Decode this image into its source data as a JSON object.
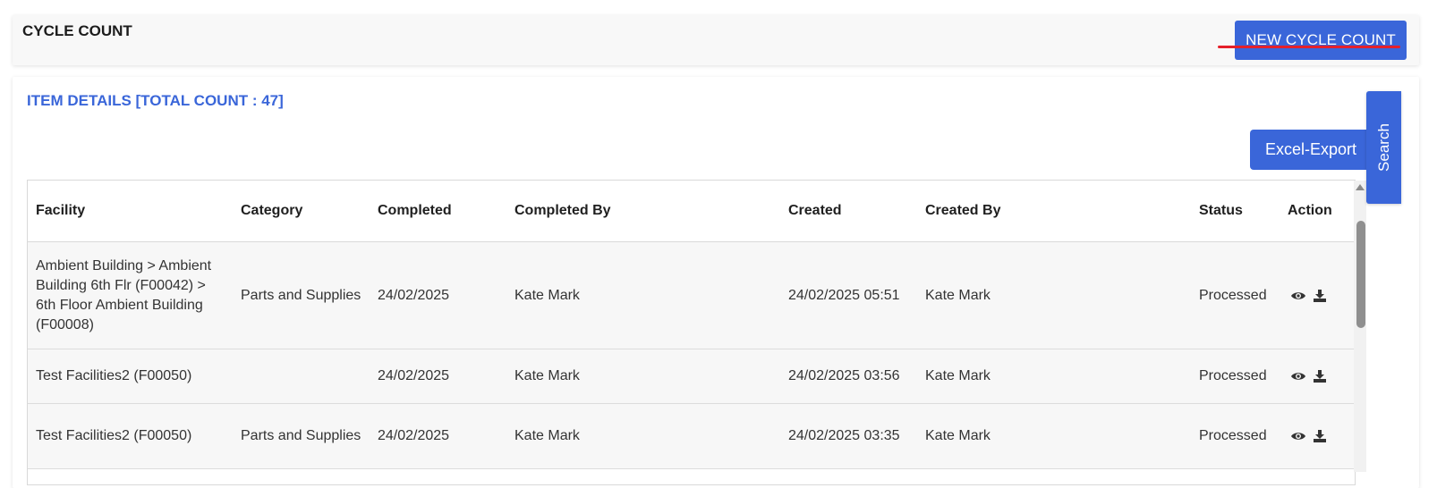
{
  "header": {
    "title": "CYCLE COUNT",
    "new_button": "NEW CYCLE COUNT"
  },
  "section": {
    "title": "ITEM DETAILS [TOTAL COUNT : 47]"
  },
  "buttons": {
    "excel_export": "Excel-Export",
    "search": "Search"
  },
  "colors": {
    "accent": "#3a66d9",
    "active_underline": "#e5202a"
  },
  "table": {
    "columns": [
      "Facility",
      "Category",
      "Completed",
      "Completed By",
      "Created",
      "Created By",
      "Status",
      "Action"
    ],
    "rows": [
      {
        "facility": "Ambient Building > Ambient Building 6th Flr (F00042) > 6th Floor Ambient Building (F00008)",
        "category": "Parts and Supplies",
        "completed": "24/02/2025",
        "completed_by": "Kate Mark",
        "created": "24/02/2025 05:51",
        "created_by": "Kate Mark",
        "status": "Processed",
        "action_icons": [
          "eye-icon",
          "download-icon"
        ]
      },
      {
        "facility": "Test Facilities2 (F00050)",
        "category": "",
        "completed": "24/02/2025",
        "completed_by": "Kate Mark",
        "created": "24/02/2025 03:56",
        "created_by": "Kate Mark",
        "status": "Processed",
        "action_icons": [
          "eye-icon",
          "download-icon"
        ]
      },
      {
        "facility": "Test Facilities2 (F00050)",
        "category": "Parts and Supplies",
        "completed": "24/02/2025",
        "completed_by": "Kate Mark",
        "created": "24/02/2025 03:35",
        "created_by": "Kate Mark",
        "status": "Processed",
        "action_icons": [
          "eye-icon",
          "download-icon"
        ]
      }
    ]
  }
}
